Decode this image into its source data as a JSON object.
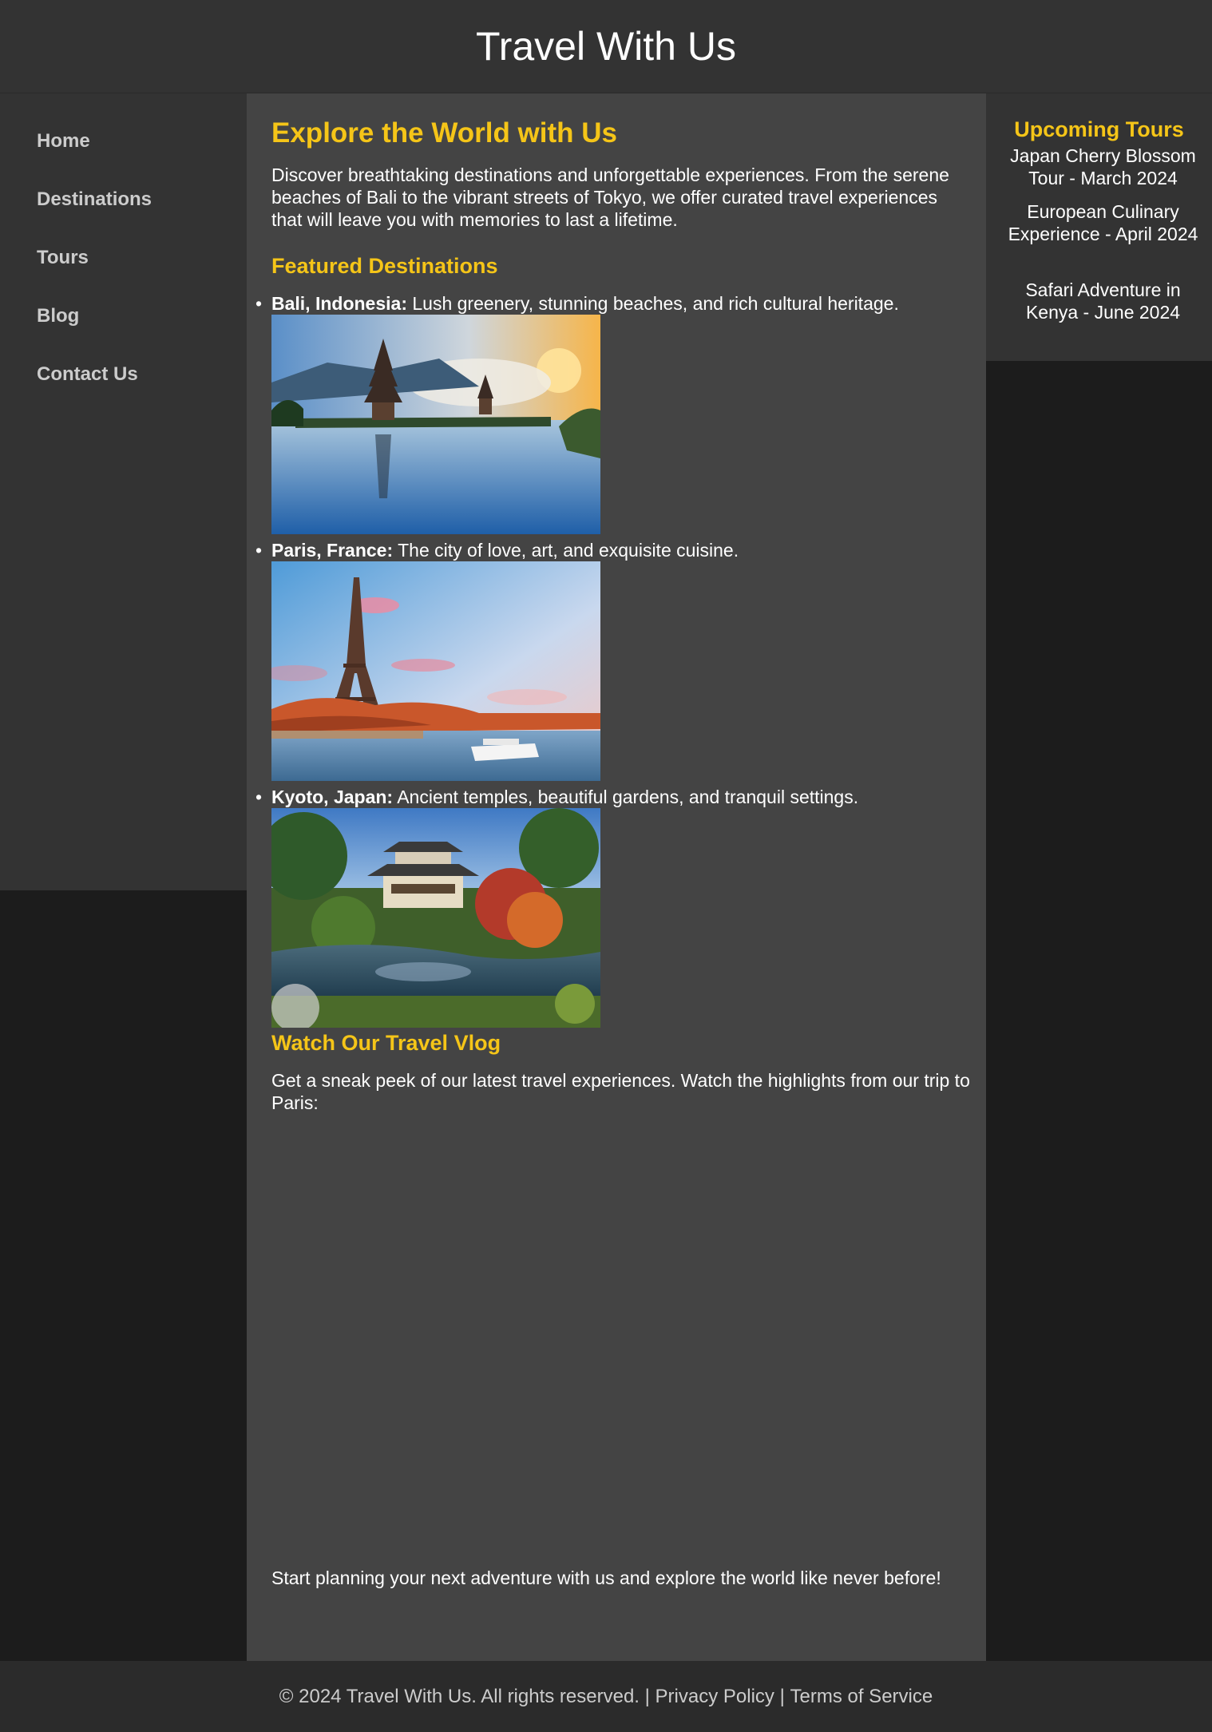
{
  "header": {
    "title": "Travel With Us"
  },
  "nav": {
    "items": [
      {
        "label": "Home"
      },
      {
        "label": "Destinations"
      },
      {
        "label": "Tours"
      },
      {
        "label": "Blog"
      },
      {
        "label": "Contact Us"
      }
    ]
  },
  "main": {
    "heading": "Explore the World with Us",
    "intro": "Discover breathtaking destinations and unforgettable experiences. From the serene beaches of Bali to the vibrant streets of Tokyo, we offer curated travel experiences that will leave you with memories to last a lifetime.",
    "featured_heading": "Featured Destinations",
    "destinations": [
      {
        "name": "Bali, Indonesia:",
        "description": " Lush greenery, stunning beaches, and rich cultural heritage."
      },
      {
        "name": "Paris, France:",
        "description": " The city of love, art, and exquisite cuisine."
      },
      {
        "name": "Kyoto, Japan:",
        "description": " Ancient temples, beautiful gardens, and tranquil settings."
      }
    ],
    "vlog_heading": "Watch Our Travel Vlog",
    "vlog_text": "Get a sneak peek of our latest travel experiences. Watch the highlights from our trip to Paris:",
    "closing": "Start planning your next adventure with us and explore the world like never before!"
  },
  "sidebar": {
    "heading": "Upcoming Tours",
    "tours": [
      "Japan Cherry Blossom Tour - March 2024",
      "European Culinary Experience - April 2024",
      "Safari Adventure in Kenya - June 2024"
    ]
  },
  "footer": {
    "copyright": "© 2024 Travel With Us. All rights reserved.",
    "separator": " | ",
    "privacy": "Privacy Policy",
    "terms": "Terms of Service"
  },
  "colors": {
    "accent": "#f5c518",
    "header_bg": "#333333",
    "content_bg": "#444444",
    "page_bg": "#1c1c1c",
    "nav_text": "#cccccc"
  }
}
